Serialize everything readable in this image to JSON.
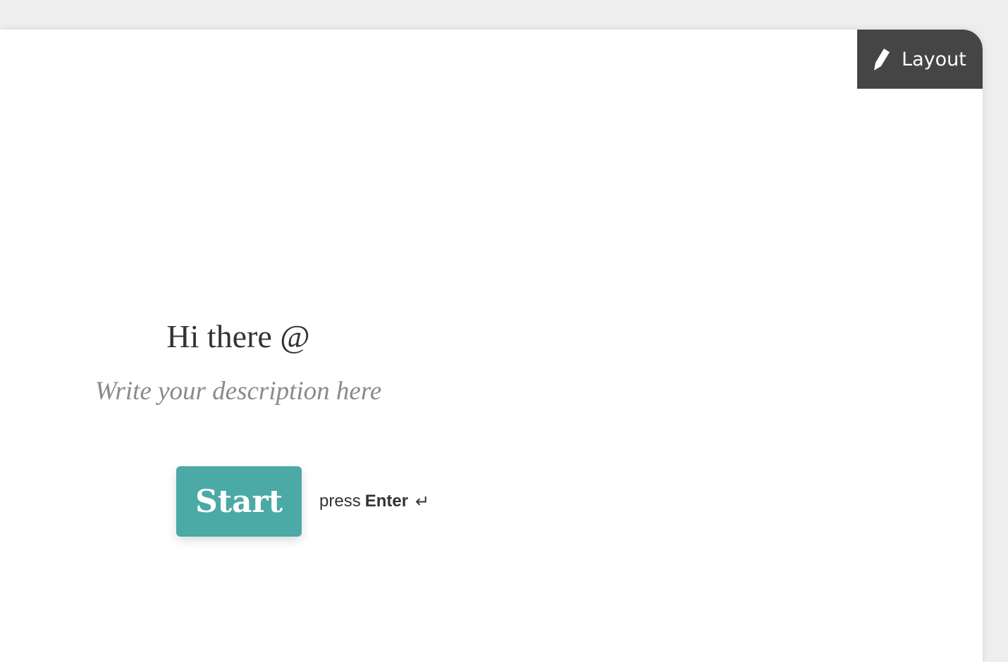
{
  "toolbar": {
    "layout_label": "Layout",
    "layout_icon": "pen-icon",
    "button_color": "#454545"
  },
  "welcome": {
    "heading": "Hi there @",
    "description_placeholder": "Write your description here"
  },
  "start": {
    "label": "Start",
    "color": "#4ba9a6"
  },
  "hint": {
    "prefix": "press",
    "key": "Enter",
    "icon": "enter-icon",
    "icon_glyph": "↵"
  }
}
